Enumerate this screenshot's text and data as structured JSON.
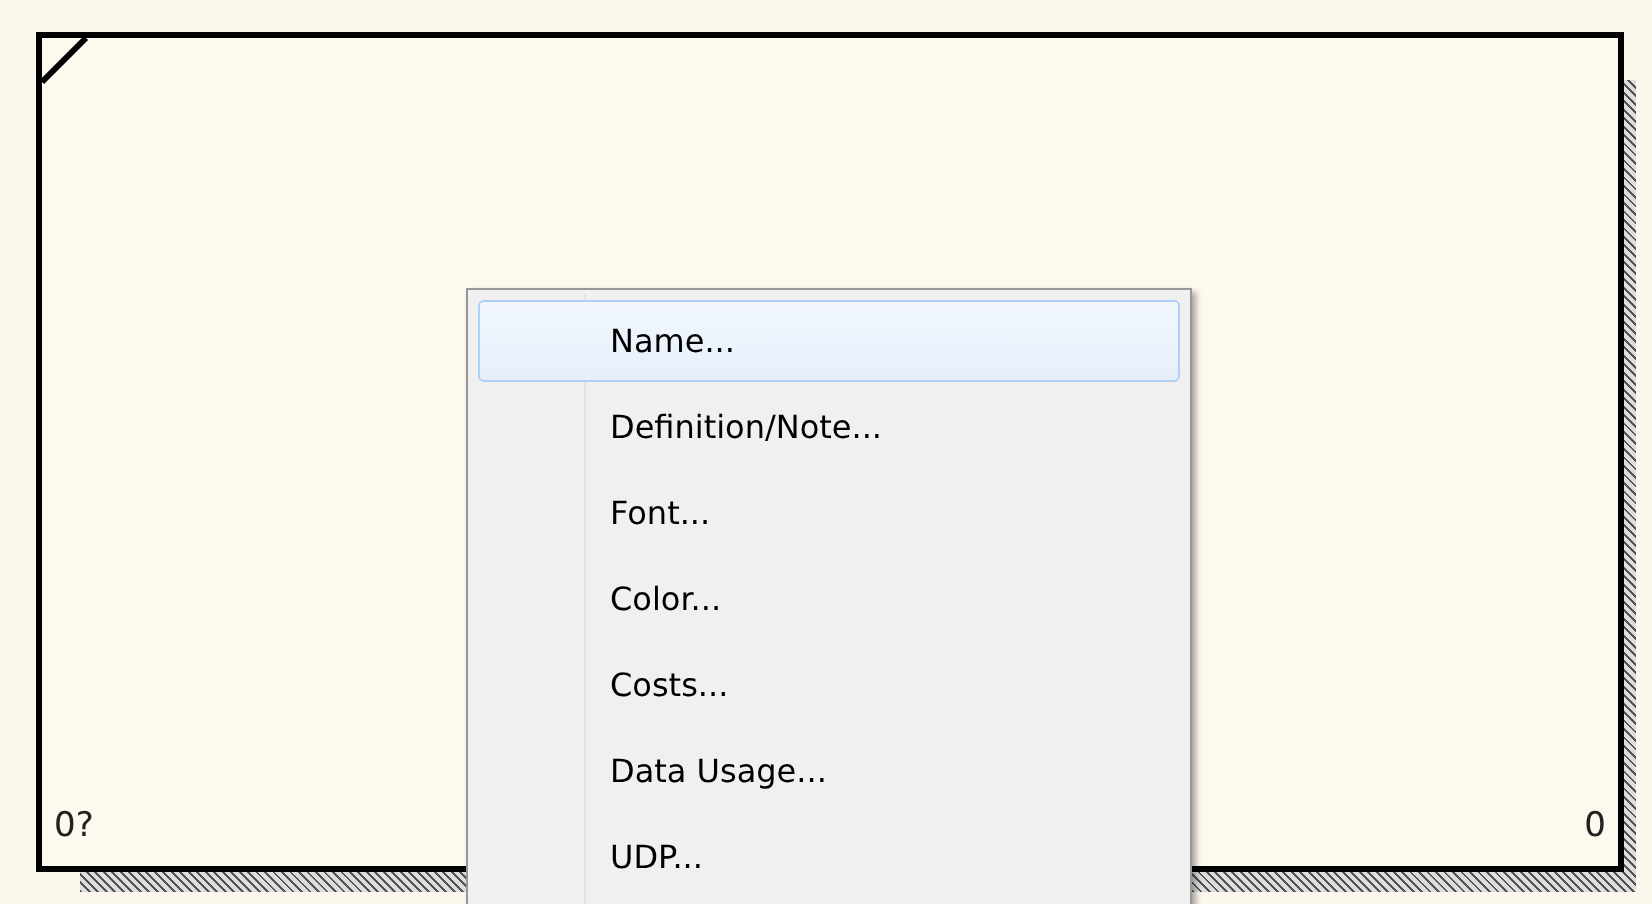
{
  "diagram_element": {
    "bottom_left_label": "0?",
    "bottom_right_label": "0"
  },
  "context_menu": {
    "items": [
      {
        "label": "Name...",
        "selected": true
      },
      {
        "label": "Definition/Note...",
        "selected": false
      },
      {
        "label": "Font...",
        "selected": false
      },
      {
        "label": "Color...",
        "selected": false
      },
      {
        "label": "Costs...",
        "selected": false
      },
      {
        "label": "Data Usage...",
        "selected": false
      },
      {
        "label": "UDP...",
        "selected": false
      }
    ]
  }
}
